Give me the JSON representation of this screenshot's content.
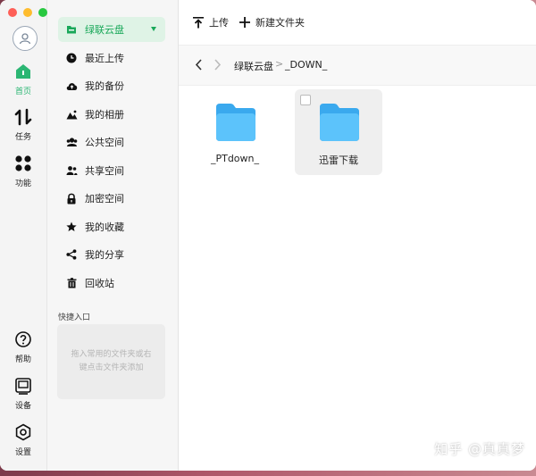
{
  "window": {
    "accent": "#1aa85a"
  },
  "rail": {
    "avatar_icon": "user-avatar-icon",
    "items": [
      {
        "label": "首页",
        "icon": "home-icon"
      },
      {
        "label": "任务",
        "icon": "transfer-icon"
      },
      {
        "label": "功能",
        "icon": "grid-icon"
      },
      {
        "label": "帮助",
        "icon": "help-icon"
      },
      {
        "label": "设备",
        "icon": "device-icon"
      },
      {
        "label": "设置",
        "icon": "settings-icon"
      }
    ]
  },
  "sidebar": {
    "items": [
      {
        "label": "绿联云盘",
        "icon": "drive-icon"
      },
      {
        "label": "最近上传",
        "icon": "clock-icon"
      },
      {
        "label": "我的备份",
        "icon": "cloud-icon"
      },
      {
        "label": "我的相册",
        "icon": "photo-icon"
      },
      {
        "label": "公共空间",
        "icon": "group-icon"
      },
      {
        "label": "共享空间",
        "icon": "share-users-icon"
      },
      {
        "label": "加密空间",
        "icon": "lock-icon"
      },
      {
        "label": "我的收藏",
        "icon": "star-icon"
      },
      {
        "label": "我的分享",
        "icon": "share-icon"
      },
      {
        "label": "回收站",
        "icon": "trash-icon"
      }
    ],
    "quick_title": "快捷入口",
    "quick_hint_1": "拖入常用的文件夹或右",
    "quick_hint_2": "键点击文件夹添加"
  },
  "toolbar": {
    "upload_label": "上传",
    "new_folder_label": "新建文件夹"
  },
  "path": {
    "crumbs": [
      "绿联云盘",
      "_DOWN_"
    ],
    "separator": ">"
  },
  "files": [
    {
      "name": "_PTdown_",
      "type": "folder"
    },
    {
      "name": "迅雷下载",
      "type": "folder",
      "hovered": true
    }
  ],
  "watermark": "知乎 @真真梦"
}
